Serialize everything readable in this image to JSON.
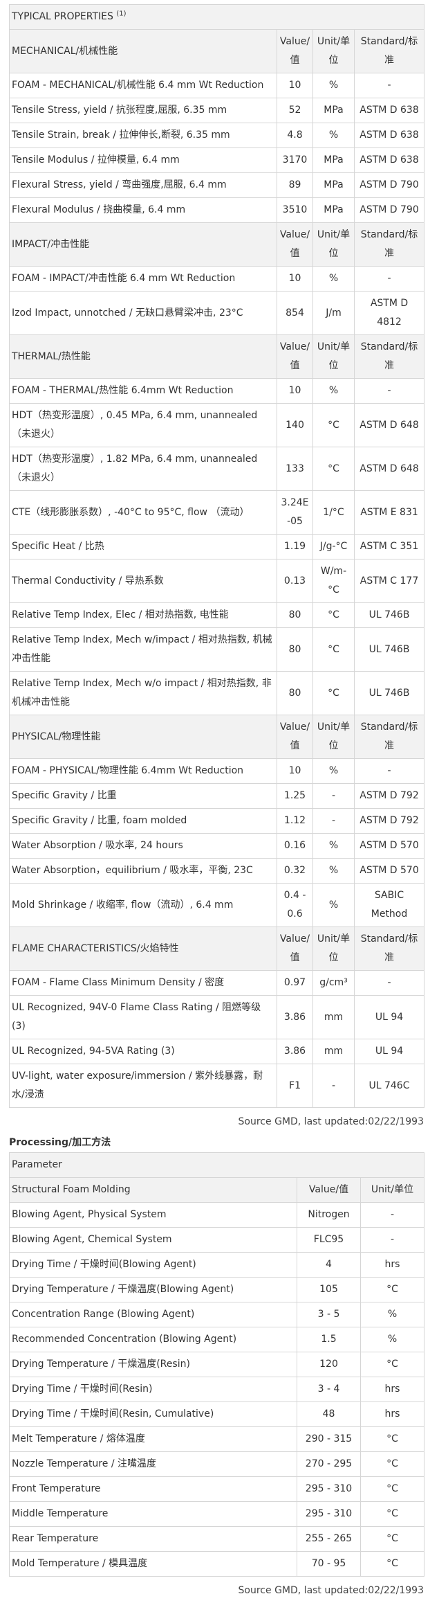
{
  "typical_properties": {
    "title": "TYPICAL PROPERTIES",
    "note": "(1)",
    "sections": [
      {
        "name": "MECHANICAL/机械性能",
        "col_value": "Value/值",
        "col_unit": "Unit/单位",
        "col_standard": "Standard/标准",
        "rows": [
          {
            "property": "FOAM - MECHANICAL/机械性能 6.4 mm Wt Reduction",
            "value": "10",
            "unit": "%",
            "standard": "-"
          },
          {
            "property": "Tensile Stress, yield / 抗张程度,屈服, 6.35 mm",
            "value": "52",
            "unit": "MPa",
            "standard": "ASTM D 638"
          },
          {
            "property": "Tensile Strain, break / 拉伸伸长,断裂, 6.35 mm",
            "value": "4.8",
            "unit": "%",
            "standard": "ASTM D 638"
          },
          {
            "property": "Tensile Modulus / 拉伸模量, 6.4 mm",
            "value": "3170",
            "unit": "MPa",
            "standard": "ASTM D 638"
          },
          {
            "property": "Flexural Stress, yield / 弯曲强度,屈服, 6.4 mm",
            "value": "89",
            "unit": "MPa",
            "standard": "ASTM D 790"
          },
          {
            "property": "Flexural Modulus / 挠曲模量, 6.4 mm",
            "value": "3510",
            "unit": "MPa",
            "standard": "ASTM D 790"
          }
        ]
      },
      {
        "name": "IMPACT/冲击性能",
        "col_value": "Value/值",
        "col_unit": "Unit/单位",
        "col_standard": "Standard/标准",
        "rows": [
          {
            "property": "FOAM - IMPACT/冲击性能 6.4 mm Wt Reduction",
            "value": "10",
            "unit": "%",
            "standard": "-"
          },
          {
            "property": "Izod Impact, unnotched / 无缺口悬臂梁冲击, 23°C",
            "value": "854",
            "unit": "J/m",
            "standard": "ASTM D 4812"
          }
        ]
      },
      {
        "name": "THERMAL/热性能",
        "col_value": "Value/值",
        "col_unit": "Unit/单位",
        "col_standard": "Standard/标准",
        "rows": [
          {
            "property": "FOAM - THERMAL/热性能 6.4mm Wt Reduction",
            "value": "10",
            "unit": "%",
            "standard": "-"
          },
          {
            "property": "HDT（热变形温度）, 0.45 MPa, 6.4 mm, unannealed （未退火）",
            "value": "140",
            "unit": "°C",
            "standard": "ASTM D 648"
          },
          {
            "property": "HDT（热变形温度）, 1.82 MPa, 6.4 mm, unannealed （未退火）",
            "value": "133",
            "unit": "°C",
            "standard": "ASTM D 648"
          },
          {
            "property": "CTE（线形膨胀系数）, -40°C to 95°C, flow （流动）",
            "value": "3.24E-05",
            "unit": "1/°C",
            "standard": "ASTM E 831"
          },
          {
            "property": "Specific Heat / 比热",
            "value": "1.19",
            "unit": "J/g-°C",
            "standard": "ASTM C 351"
          },
          {
            "property": "Thermal Conductivity / 导热系数",
            "value": "0.13",
            "unit": "W/m-°C",
            "standard": "ASTM C 177"
          },
          {
            "property": "Relative Temp Index, Elec / 相对热指数, 电性能",
            "value": "80",
            "unit": "°C",
            "standard": "UL 746B"
          },
          {
            "property": "Relative Temp Index, Mech w/impact / 相对热指数, 机械冲击性能",
            "value": "80",
            "unit": "°C",
            "standard": "UL 746B"
          },
          {
            "property": "Relative Temp Index, Mech w/o impact / 相对热指数, 非机械冲击性能",
            "value": "80",
            "unit": "°C",
            "standard": "UL 746B"
          }
        ]
      },
      {
        "name": "PHYSICAL/物理性能",
        "col_value": "Value/值",
        "col_unit": "Unit/单位",
        "col_standard": "Standard/标准",
        "rows": [
          {
            "property": "FOAM - PHYSICAL/物理性能 6.4mm Wt Reduction",
            "value": "10",
            "unit": "%",
            "standard": "-"
          },
          {
            "property": "Specific Gravity / 比重",
            "value": "1.25",
            "unit": "-",
            "standard": "ASTM D 792"
          },
          {
            "property": "Specific Gravity / 比重, foam molded",
            "value": "1.12",
            "unit": "-",
            "standard": "ASTM D 792"
          },
          {
            "property": "Water Absorption / 吸水率, 24 hours",
            "value": "0.16",
            "unit": "%",
            "standard": "ASTM D 570"
          },
          {
            "property": "Water Absorption，equilibrium / 吸水率，平衡, 23C",
            "value": "0.32",
            "unit": "%",
            "standard": "ASTM D 570"
          },
          {
            "property": "Mold Shrinkage / 收缩率, flow（流动）, 6.4 mm",
            "value": "0.4 - 0.6",
            "unit": "%",
            "standard": "SABIC Method"
          }
        ]
      },
      {
        "name": "FLAME CHARACTERISTICS/火焰特性",
        "col_value": "Value/值",
        "col_unit": "Unit/单位",
        "col_standard": "Standard/标准",
        "rows": [
          {
            "property": "FOAM - Flame Class Minimum Density / 密度",
            "value": "0.97",
            "unit": "g/cm³",
            "standard": "-"
          },
          {
            "property": "UL Recognized, 94V-0 Flame Class Rating / 阻燃等级 (3)",
            "value": "3.86",
            "unit": "mm",
            "standard": "UL 94"
          },
          {
            "property": "UL Recognized, 94-5VA Rating (3)",
            "value": "3.86",
            "unit": "mm",
            "standard": "UL 94"
          },
          {
            "property": "UV-light, water exposure/immersion / 紫外线暴露，耐水/浸渍",
            "value": "F1",
            "unit": "-",
            "standard": "UL 746C"
          }
        ]
      }
    ],
    "source": "Source GMD, last updated:02/22/1993"
  },
  "processing": {
    "title": "Processing/加工方法",
    "header": "Parameter",
    "subheader": "Structural Foam Molding",
    "col_value": "Value/值",
    "col_unit": "Unit/单位",
    "rows": [
      {
        "parameter": "Blowing Agent, Physical System",
        "value": "Nitrogen",
        "unit": "-"
      },
      {
        "parameter": "Blowing Agent, Chemical System",
        "value": "FLC95",
        "unit": "-"
      },
      {
        "parameter": "Drying Time / 干燥时间(Blowing Agent)",
        "value": "4",
        "unit": "hrs"
      },
      {
        "parameter": "Drying Temperature / 干燥温度(Blowing Agent)",
        "value": "105",
        "unit": "°C"
      },
      {
        "parameter": "Concentration Range (Blowing Agent)",
        "value": "3 - 5",
        "unit": "%"
      },
      {
        "parameter": "Recommended Concentration (Blowing Agent)",
        "value": "1.5",
        "unit": "%"
      },
      {
        "parameter": "Drying Temperature / 干燥温度(Resin)",
        "value": "120",
        "unit": "°C"
      },
      {
        "parameter": "Drying Time / 干燥时间(Resin)",
        "value": "3 - 4",
        "unit": "hrs"
      },
      {
        "parameter": "Drying Time / 干燥时间(Resin, Cumulative)",
        "value": "48",
        "unit": "hrs"
      },
      {
        "parameter": "Melt Temperature / 熔体温度",
        "value": "290 - 315",
        "unit": "°C"
      },
      {
        "parameter": "Nozzle Temperature / 注嘴温度",
        "value": "270 - 295",
        "unit": "°C"
      },
      {
        "parameter": "Front Temperature",
        "value": "295 - 310",
        "unit": "°C"
      },
      {
        "parameter": "Middle Temperature",
        "value": "295 - 310",
        "unit": "°C"
      },
      {
        "parameter": "Rear Temperature",
        "value": "255 - 265",
        "unit": "°C"
      },
      {
        "parameter": "Mold Temperature / 模具温度",
        "value": "70 - 95",
        "unit": "°C"
      }
    ],
    "source": "Source GMD, last updated:02/22/1993"
  }
}
